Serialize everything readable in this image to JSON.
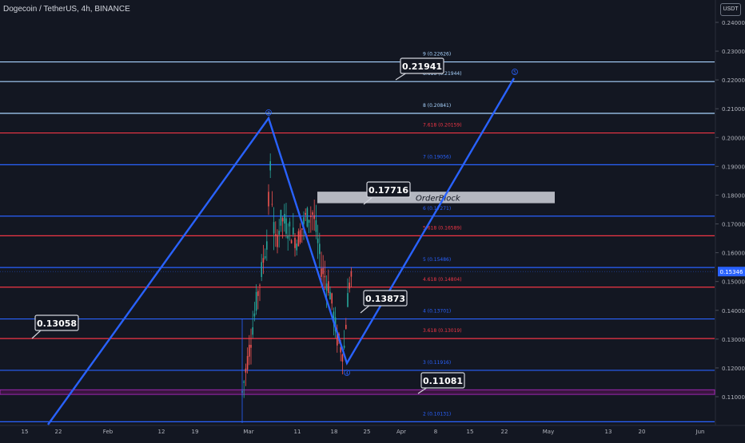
{
  "header": {
    "symbol": "Dogecoin / TetherUS, 4h, BINANCE",
    "currency": "USDT"
  },
  "colors": {
    "background": "#131722",
    "blue": "#2962ff",
    "red": "#f23645",
    "light_blue": "#a9d4ff",
    "purple": "#9c27b0",
    "axis_text": "#b2b5be",
    "price_label_bg": "#2962ff"
  },
  "chart_data": {
    "type": "line",
    "title": "Dogecoin / TetherUS, 4h, BINANCE",
    "y_axis": {
      "ticks": [
        "0.24000",
        "0.23000",
        "0.22000",
        "0.21000",
        "0.20000",
        "0.19000",
        "0.18000",
        "0.17000",
        "0.16000",
        "0.15000",
        "0.14000",
        "0.13000",
        "0.12000",
        "0.11000"
      ]
    },
    "x_axis": {
      "ticks": [
        "15",
        "22",
        "Feb",
        "12",
        "19",
        "Mar",
        "11",
        "18",
        "25",
        "Apr",
        "8",
        "15",
        "22",
        "May",
        "13",
        "20",
        "Jun"
      ]
    },
    "current_price": "0.15346",
    "fib_levels": [
      {
        "label": "9 (0.22626)",
        "value": 0.22626,
        "color": "light_blue"
      },
      {
        "label": "8.618 (0.21944)",
        "value": 0.21944,
        "color": "light_blue"
      },
      {
        "label": "8 (0.20841)",
        "value": 0.20841,
        "color": "light_blue"
      },
      {
        "label": "7.618 (0.20159)",
        "value": 0.20159,
        "color": "red"
      },
      {
        "label": "7 (0.19056)",
        "value": 0.19056,
        "color": "blue"
      },
      {
        "label": "6 (0.17271)",
        "value": 0.17271,
        "color": "blue"
      },
      {
        "label": "5.618 (0.16589)",
        "value": 0.16589,
        "color": "red"
      },
      {
        "label": "5 (0.15486)",
        "value": 0.15486,
        "color": "blue"
      },
      {
        "label": "4.618 (0.14804)",
        "value": 0.14804,
        "color": "red"
      },
      {
        "label": "4 (0.13701)",
        "value": 0.13701,
        "color": "blue"
      },
      {
        "label": "3.618 (0.13019)",
        "value": 0.13019,
        "color": "red"
      },
      {
        "label": "3 (0.11916)",
        "value": 0.11916,
        "color": "blue"
      },
      {
        "label": "2 (0.10131)",
        "value": 0.10131,
        "color": "blue"
      }
    ],
    "callouts": [
      {
        "text": "0.21941",
        "value": 0.21941
      },
      {
        "text": "0.17716",
        "value": 0.17716
      },
      {
        "text": "0.13873",
        "value": 0.13873
      },
      {
        "text": "0.13058",
        "value": 0.13058
      },
      {
        "text": "0.11081",
        "value": 0.11081
      }
    ],
    "order_block": {
      "label": "OrderBlock",
      "low": 0.1772,
      "high": 0.1812
    },
    "wave_labels": [
      "3",
      "4",
      "5"
    ]
  }
}
